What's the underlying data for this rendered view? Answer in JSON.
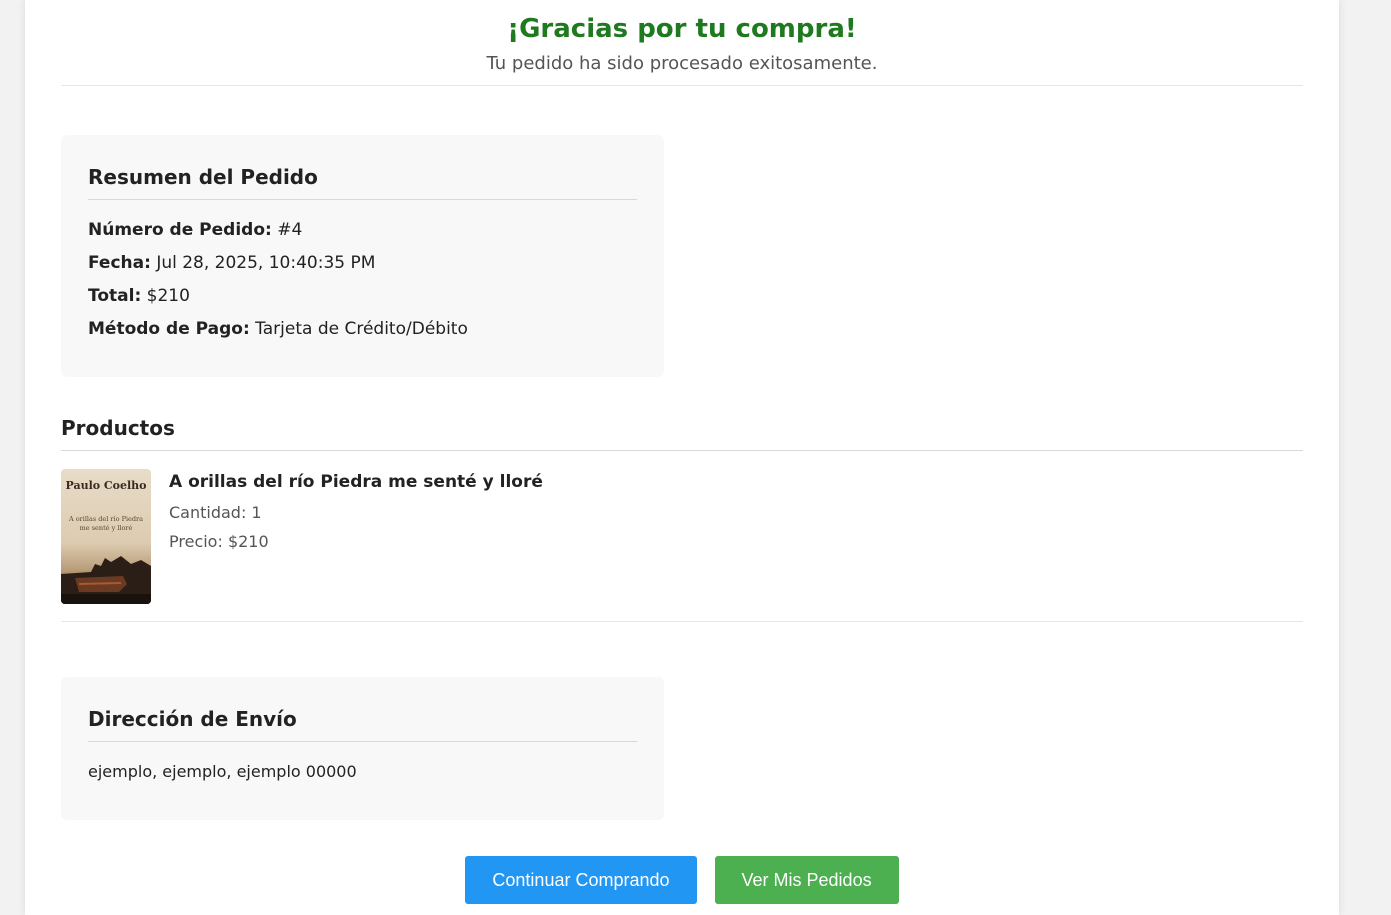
{
  "header": {
    "title": "¡Gracias por tu compra!",
    "subtitle": "Tu pedido ha sido procesado exitosamente."
  },
  "summary": {
    "heading": "Resumen del Pedido",
    "rows": [
      {
        "label": "Número de Pedido:",
        "value": "#4"
      },
      {
        "label": "Fecha:",
        "value": "Jul 28, 2025, 10:40:35 PM"
      },
      {
        "label": "Total:",
        "value": "$210"
      },
      {
        "label": "Método de Pago:",
        "value": "Tarjeta de Crédito/Débito"
      }
    ]
  },
  "products": {
    "heading": "Productos",
    "items": [
      {
        "name": "A orillas del río Piedra me senté y lloré",
        "quantity": "Cantidad: 1",
        "price": "Precio: $210",
        "cover_author": "Paulo Coelho",
        "cover_title": "A orillas del río Piedra me senté y lloré"
      }
    ]
  },
  "shipping": {
    "heading": "Dirección de Envío",
    "address": "ejemplo, ejemplo, ejemplo 00000"
  },
  "actions": {
    "continue_label": "Continuar Comprando",
    "orders_label": "Ver Mis Pedidos"
  },
  "colors": {
    "title_green": "#1f7a1f",
    "continue_blue": "#2196f3",
    "orders_green": "#4caf50"
  }
}
